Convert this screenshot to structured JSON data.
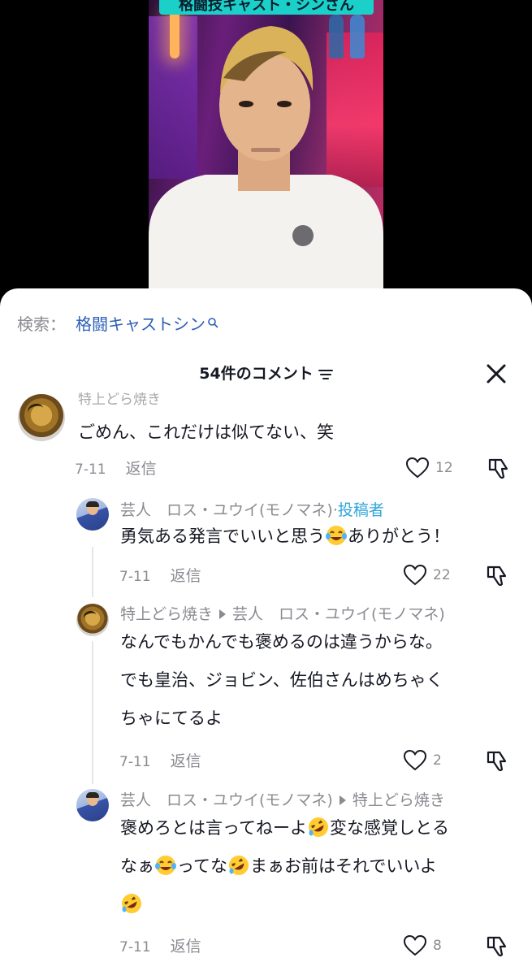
{
  "video": {
    "caption": "格闘技キャスト・シンさん"
  },
  "sheet": {
    "search_label": "検索：",
    "search_query": "格闘キャストシン",
    "header_title": "54件のコメント",
    "comments": [
      {
        "partial_name": "特上どら焼き",
        "text": "ごめん、これだけは似てない、笑",
        "date": "7-11",
        "reply_label": "返信",
        "likes": "12"
      }
    ],
    "replies": [
      {
        "name": "芸人　ロス・ユウイ(モノマネ)",
        "separator": "·",
        "badge": "投稿者",
        "line1_before": "勇気ある発言でいいと思う",
        "line1_after": "ありがとう！",
        "date": "7-11",
        "reply_label": "返信",
        "likes": "22"
      },
      {
        "name": "特上どら焼き",
        "reply_to": "芸人　ロス・ユウイ(モノマネ)",
        "line1": "なんでもかんでも褒めるのは違うからな。",
        "line2": "でも皇治、ジョビン、佐伯さんはめちゃく",
        "line3": "ちゃにてるよ",
        "date": "7-11",
        "reply_label": "返信",
        "likes": "2"
      },
      {
        "name": "芸人　ロス・ユウイ(モノマネ)",
        "reply_to": "特上どら焼き",
        "line1_before": "褒めろとは言ってねーよ",
        "line1_after": "変な感覚しとる",
        "line2_a": "なぁ",
        "line2_b": "ってな",
        "line2_c": "まぁお前はそれでいいよ",
        "date": "7-11",
        "reply_label": "返信",
        "likes": "8"
      }
    ]
  },
  "icons": {
    "emoji_tears": "face-with-tears-of-joy",
    "emoji_rofl": "rolling-on-floor-laughing",
    "like": "heart-outline-icon",
    "dislike": "thumbs-down-outline-icon",
    "close": "close-x-icon",
    "sort": "sort-icon",
    "search": "search-icon"
  },
  "colors": {
    "author_badge": "#2fa6d9",
    "search_link": "#2c5fb6",
    "caption_bg": "#1ad0c8"
  }
}
